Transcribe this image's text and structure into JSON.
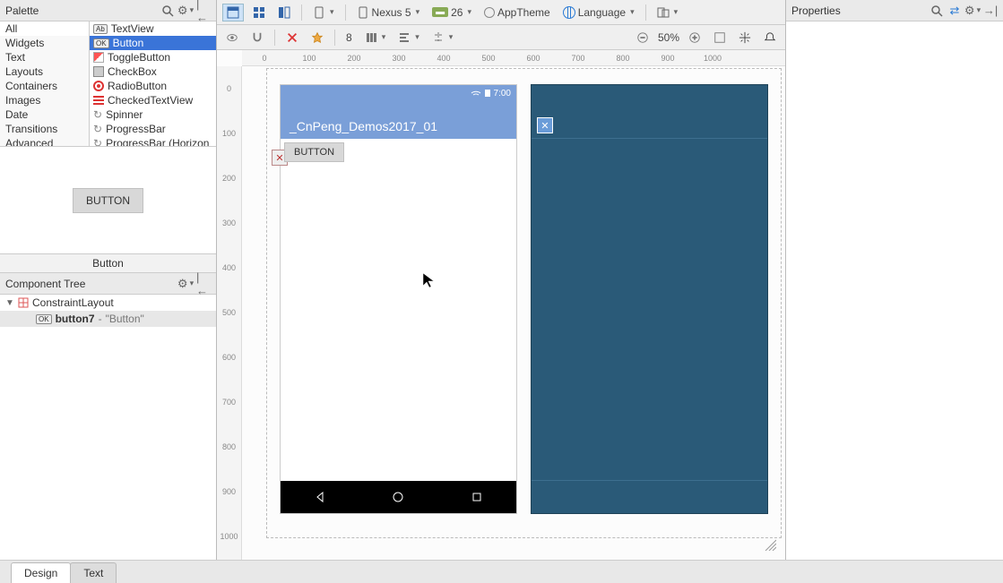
{
  "palette": {
    "title": "Palette",
    "categories": [
      "All",
      "Widgets",
      "Text",
      "Layouts",
      "Containers",
      "Images",
      "Date",
      "Transitions",
      "Advanced"
    ],
    "widgets": [
      {
        "badge": "Ab",
        "label": "TextView"
      },
      {
        "badge": "OK",
        "label": "Button",
        "selected": true
      },
      {
        "badge": "",
        "label": "ToggleButton"
      },
      {
        "badge": "",
        "label": "CheckBox"
      },
      {
        "badge": "",
        "label": "RadioButton"
      },
      {
        "badge": "",
        "label": "CheckedTextView"
      },
      {
        "badge": "",
        "label": "Spinner"
      },
      {
        "badge": "",
        "label": "ProgressBar"
      },
      {
        "badge": "",
        "label": "ProgressBar (Horizon"
      }
    ],
    "preview_button": "BUTTON",
    "preview_label": "Button"
  },
  "tree": {
    "title": "Component Tree",
    "root": "ConstraintLayout",
    "child_id": "button7",
    "child_text": "\"Button\""
  },
  "toolbar": {
    "device": "Nexus 5",
    "api": "26",
    "theme": "AppTheme",
    "locale": "Language",
    "margin": "8",
    "zoom": "50%"
  },
  "device": {
    "time": "7:00",
    "app_title": "_CnPeng_Demos2017_01",
    "button": "BUTTON"
  },
  "properties": {
    "title": "Properties"
  },
  "footer": {
    "design": "Design",
    "text": "Text"
  }
}
